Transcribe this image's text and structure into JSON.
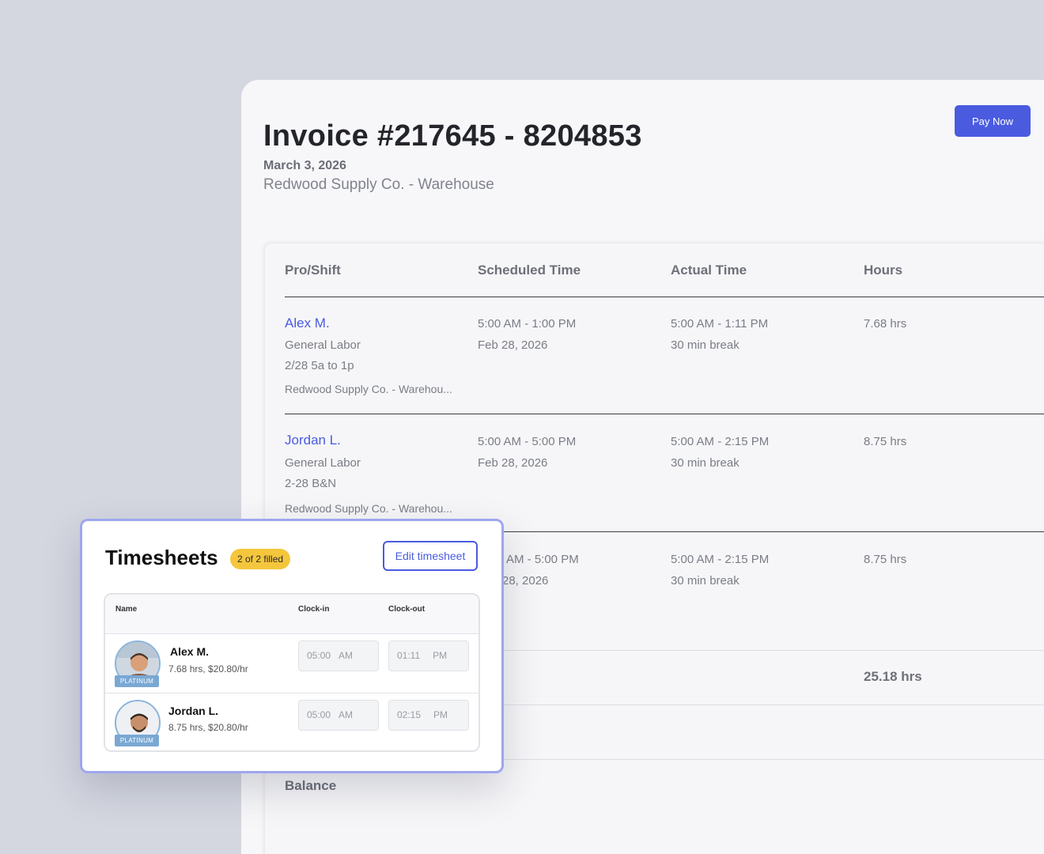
{
  "invoice": {
    "title": "Invoice #217645 - 8204853",
    "date": "March 3, 2026",
    "company": "Redwood Supply Co. - Warehouse",
    "pay_label": "Pay Now"
  },
  "table": {
    "headers": [
      "Pro/Shift",
      "Scheduled Time",
      "Actual Time",
      "Hours"
    ],
    "rows": [
      {
        "name": "Alex M.",
        "role": "General Labor",
        "shift": "2/28 5a to 1p",
        "location": "Redwood Supply Co. - Warehou...",
        "scheduled": "5:00 AM - 1:00 PM",
        "scheduled_date": "Feb 28, 2026",
        "actual": "5:00 AM - 1:11 PM",
        "break": "30 min break",
        "hours": "7.68 hrs"
      },
      {
        "name": "Jordan L.",
        "role": "General Labor",
        "shift": "2-28 B&N",
        "location": "Redwood Supply Co. - Warehou...",
        "scheduled": "5:00 AM - 5:00 PM",
        "scheduled_date": "Feb 28, 2026",
        "actual": "5:00 AM - 2:15 PM",
        "break": "30 min break",
        "hours": "8.75 hrs"
      },
      {
        "scheduled_partial": "AM - 5:00 PM",
        "scheduled_date_partial": "28, 2026",
        "actual": "5:00 AM - 2:15 PM",
        "break": "30 min break",
        "hours": "8.75 hrs"
      }
    ],
    "total_hours": "25.18 hrs",
    "balance_label": "Balance"
  },
  "timesheets": {
    "title": "Timesheets",
    "badge": "2 of 2 filled",
    "edit_label": "Edit timesheet",
    "headers": {
      "name": "Name",
      "clock_in": "Clock-in",
      "clock_out": "Clock-out"
    },
    "rows": [
      {
        "name": "Alex M.",
        "meta": "7.68 hrs, $20.80/hr",
        "tier": "PLATINUM",
        "in_time": "05:00",
        "in_ampm": "AM",
        "out_time": "01:11",
        "out_ampm": "PM"
      },
      {
        "name": "Jordan L.",
        "meta": "8.75 hrs, $20.80/hr",
        "tier": "PLATINUM",
        "in_time": "05:00",
        "in_ampm": "AM",
        "out_time": "02:15",
        "out_ampm": "PM"
      }
    ]
  }
}
